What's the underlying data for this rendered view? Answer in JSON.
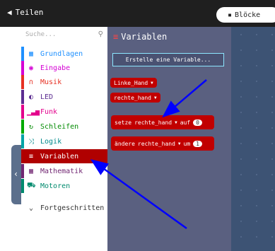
{
  "topbar": {
    "share_label": "Teilen",
    "blocks_label": "Blöcke"
  },
  "search": {
    "placeholder": "Suche..."
  },
  "categories": [
    {
      "label": "Grundlagen",
      "color": "#1e90ff",
      "icon": "grid-icon"
    },
    {
      "label": "Eingabe",
      "color": "#d400d4",
      "icon": "target-icon"
    },
    {
      "label": "Musik",
      "color": "#e63022",
      "icon": "headphones-icon"
    },
    {
      "label": "LED",
      "color": "#5c2d91",
      "icon": "toggle-icon"
    },
    {
      "label": "Funk",
      "color": "#e3008c",
      "icon": "signal-icon"
    },
    {
      "label": "Schleifen",
      "color": "#00aa00",
      "icon": "loop-icon"
    },
    {
      "label": "Logik",
      "color": "#00a4a6",
      "icon": "shuffle-icon"
    },
    {
      "label": "Variablen",
      "color": "#b00000",
      "icon": "list-icon"
    },
    {
      "label": "Mathematik",
      "color": "#712672",
      "icon": "calculator-icon"
    },
    {
      "label": "Motoren",
      "color": "#008a6d",
      "icon": "car-icon"
    },
    {
      "label": "Fortgeschritten",
      "color": "#333333",
      "icon": "chevron-down-icon"
    }
  ],
  "flyout": {
    "title": "Variablen",
    "make_variable": "Erstelle eine Variable...",
    "var1": "Linke_Hand",
    "var2": "rechte_hand",
    "set_block": {
      "keyword": "setze",
      "var": "rechte_hand",
      "to": "auf",
      "value": "0"
    },
    "change_block": {
      "keyword": "ändere",
      "var": "rechte_hand",
      "by": "um",
      "value": "1"
    }
  },
  "colors": {
    "accent": "#b00000",
    "arrow": "#0000ff"
  }
}
